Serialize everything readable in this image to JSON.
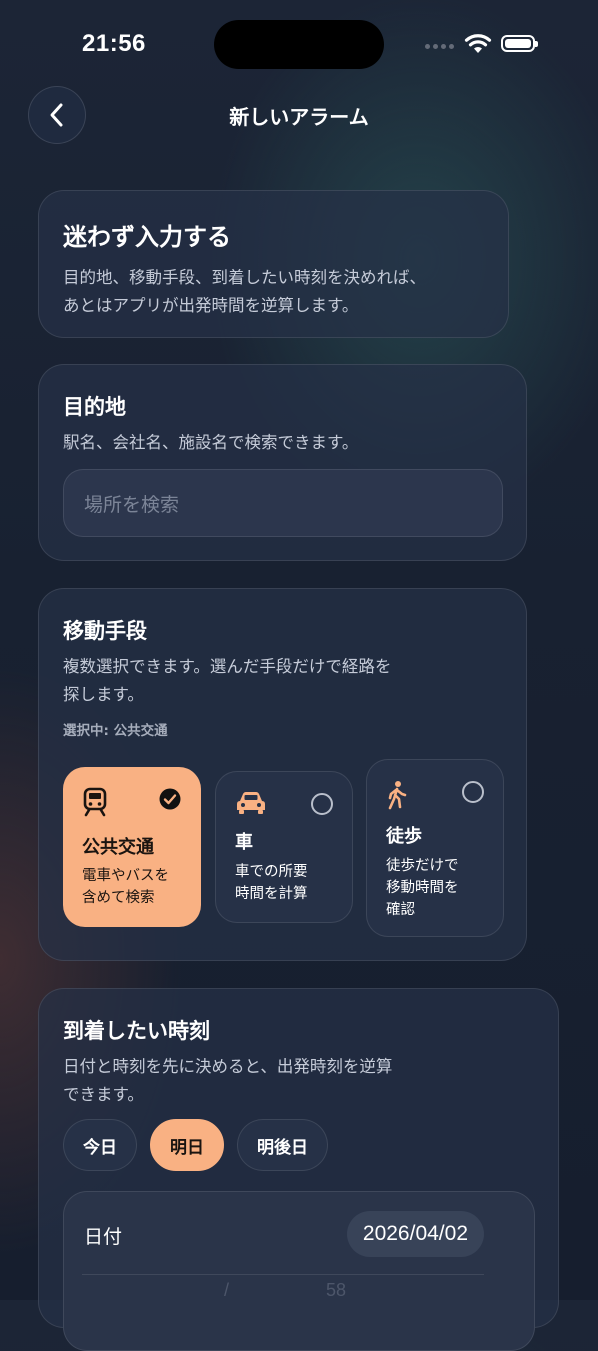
{
  "status_bar": {
    "time": "21:56"
  },
  "nav": {
    "title": "新しいアラーム"
  },
  "intro": {
    "title": "迷わず入力する",
    "body_line1": "目的地、移動手段、到着したい時刻を決めれば、",
    "body_line2": "あとはアプリが出発時間を逆算します。"
  },
  "destination": {
    "title": "目的地",
    "description": "駅名、会社名、施設名で検索できます。",
    "search_placeholder": "場所を検索"
  },
  "transport": {
    "title": "移動手段",
    "description_line1": "複数選択できます。選んだ手段だけで経路を",
    "description_line2": "探します。",
    "selected_label": "選択中: 公共交通",
    "options": [
      {
        "name": "公共交通",
        "desc_line1": "電車やバスを",
        "desc_line2": "含めて検索",
        "desc_line3": "",
        "icon": "train-icon",
        "selected": true
      },
      {
        "name": "車",
        "desc_line1": "車での所要",
        "desc_line2": "時間を計算",
        "desc_line3": "",
        "icon": "car-icon",
        "selected": false
      },
      {
        "name": "徒歩",
        "desc_line1": "徒歩だけで",
        "desc_line2": "移動時間を",
        "desc_line3": "確認",
        "icon": "walking-icon",
        "selected": false
      }
    ]
  },
  "arrival": {
    "title": "到着したい時刻",
    "description_line1": "日付と時刻を先に決めると、出発時刻を逆算",
    "description_line2": "できます。",
    "day_chips": [
      "今日",
      "明日",
      "明後日"
    ],
    "active_chip": "明日",
    "date_label": "日付",
    "date_value": "2026/04/02",
    "wheel_hint_left": "/",
    "wheel_hint_right": "58"
  },
  "colors": {
    "accent": "#f9b183",
    "background": "#182131",
    "card": "#263147"
  }
}
